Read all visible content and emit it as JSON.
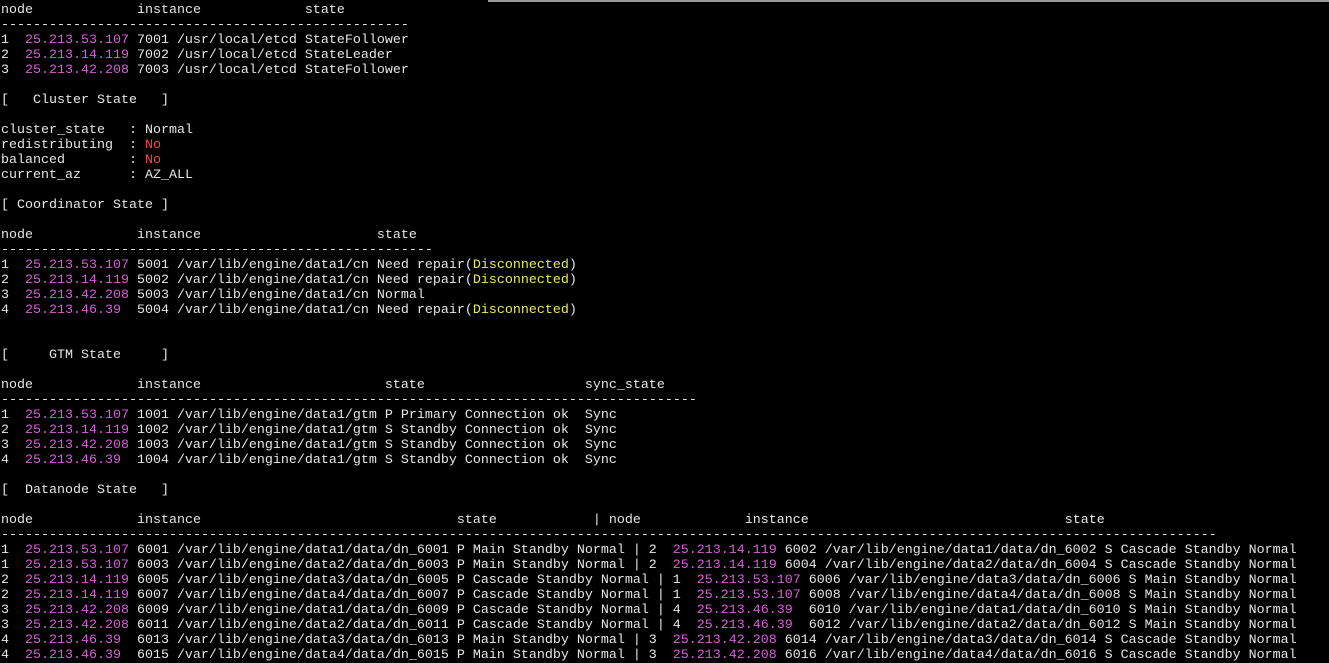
{
  "theme": {
    "background": "#000000",
    "foreground": "#e6e6e6",
    "ip_color": "#d75fd7",
    "error_color": "#f04848",
    "warning_color": "#ecec4a"
  },
  "etcd": {
    "header": {
      "node": "node",
      "instance": "instance",
      "state": "state"
    },
    "separator": "---------------------------------------------------",
    "rows": [
      {
        "node": "1",
        "ip": "25.213.53.107",
        "port": "7001",
        "path": "/usr/local/etcd",
        "state": "StateFollower"
      },
      {
        "node": "2",
        "ip": "25.213.14.119",
        "port": "7002",
        "path": "/usr/local/etcd",
        "state": "StateLeader"
      },
      {
        "node": "3",
        "ip": "25.213.42.208",
        "port": "7003",
        "path": "/usr/local/etcd",
        "state": "StateFollower"
      }
    ]
  },
  "cluster": {
    "title": "[   Cluster State   ]",
    "delimiter": ":",
    "items": [
      {
        "key": "cluster_state",
        "value": "Normal"
      },
      {
        "key": "redistributing",
        "value": "No"
      },
      {
        "key": "balanced",
        "value": "No"
      },
      {
        "key": "current_az",
        "value": "AZ_ALL"
      }
    ]
  },
  "coordinator": {
    "title": "[ Coordinator State ]",
    "header": {
      "node": "node",
      "instance": "instance",
      "state": "state"
    },
    "separator": "------------------------------------------------------",
    "detail_brackets": [
      "(",
      ")"
    ],
    "rows": [
      {
        "node": "1",
        "ip": "25.213.53.107",
        "port": "5001",
        "path": "/var/lib/engine/data1/cn",
        "state": "Need repair",
        "detail": "Disconnected"
      },
      {
        "node": "2",
        "ip": "25.213.14.119",
        "port": "5002",
        "path": "/var/lib/engine/data1/cn",
        "state": "Need repair",
        "detail": "Disconnected"
      },
      {
        "node": "3",
        "ip": "25.213.42.208",
        "port": "5003",
        "path": "/var/lib/engine/data1/cn",
        "state": "Normal"
      },
      {
        "node": "4",
        "ip": "25.213.46.39",
        "port": "5004",
        "path": "/var/lib/engine/data1/cn",
        "state": "Need repair",
        "detail": "Disconnected"
      }
    ]
  },
  "gtm": {
    "title": "[     GTM State     ]",
    "header": {
      "node": "node",
      "instance": "instance",
      "state": "state",
      "sync_state": "sync_state"
    },
    "separator": "---------------------------------------------------------------------------------------",
    "rows": [
      {
        "node": "1",
        "ip": "25.213.53.107",
        "port": "1001",
        "path": "/var/lib/engine/data1/gtm",
        "state": "P Primary Connection ok",
        "sync_state": "Sync"
      },
      {
        "node": "2",
        "ip": "25.213.14.119",
        "port": "1002",
        "path": "/var/lib/engine/data1/gtm",
        "state": "S Standby Connection ok",
        "sync_state": "Sync"
      },
      {
        "node": "3",
        "ip": "25.213.42.208",
        "port": "1003",
        "path": "/var/lib/engine/data1/gtm",
        "state": "S Standby Connection ok",
        "sync_state": "Sync"
      },
      {
        "node": "4",
        "ip": "25.213.46.39",
        "port": "1004",
        "path": "/var/lib/engine/data1/gtm",
        "state": "S Standby Connection ok",
        "sync_state": "Sync"
      }
    ]
  },
  "datanode": {
    "title": "[  Datanode State   ]",
    "header": {
      "node": "node",
      "instance": "instance",
      "state": "state"
    },
    "divider": "|",
    "separator": "--------------------------------------------------------------------------------------------------------------------------------------------------------",
    "rows": [
      {
        "left": {
          "node": "1",
          "ip": "25.213.53.107",
          "port": "6001",
          "path": "/var/lib/engine/data1/data/dn_6001",
          "state": "P Main Standby Normal"
        },
        "right": {
          "node": "2",
          "ip": "25.213.14.119",
          "port": "6002",
          "path": "/var/lib/engine/data1/data/dn_6002",
          "state": "S Cascade Standby Normal"
        }
      },
      {
        "left": {
          "node": "1",
          "ip": "25.213.53.107",
          "port": "6003",
          "path": "/var/lib/engine/data2/data/dn_6003",
          "state": "P Main Standby Normal"
        },
        "right": {
          "node": "2",
          "ip": "25.213.14.119",
          "port": "6004",
          "path": "/var/lib/engine/data2/data/dn_6004",
          "state": "S Cascade Standby Normal"
        }
      },
      {
        "left": {
          "node": "2",
          "ip": "25.213.14.119",
          "port": "6005",
          "path": "/var/lib/engine/data3/data/dn_6005",
          "state": "P Cascade Standby Normal"
        },
        "right": {
          "node": "1",
          "ip": "25.213.53.107",
          "port": "6006",
          "path": "/var/lib/engine/data3/data/dn_6006",
          "state": "S Main Standby Normal"
        }
      },
      {
        "left": {
          "node": "2",
          "ip": "25.213.14.119",
          "port": "6007",
          "path": "/var/lib/engine/data4/data/dn_6007",
          "state": "P Cascade Standby Normal"
        },
        "right": {
          "node": "1",
          "ip": "25.213.53.107",
          "port": "6008",
          "path": "/var/lib/engine/data4/data/dn_6008",
          "state": "S Main Standby Normal"
        }
      },
      {
        "left": {
          "node": "3",
          "ip": "25.213.42.208",
          "port": "6009",
          "path": "/var/lib/engine/data1/data/dn_6009",
          "state": "P Cascade Standby Normal"
        },
        "right": {
          "node": "4",
          "ip": "25.213.46.39",
          "port": "6010",
          "path": "/var/lib/engine/data1/data/dn_6010",
          "state": "S Main Standby Normal"
        }
      },
      {
        "left": {
          "node": "3",
          "ip": "25.213.42.208",
          "port": "6011",
          "path": "/var/lib/engine/data2/data/dn_6011",
          "state": "P Cascade Standby Normal"
        },
        "right": {
          "node": "4",
          "ip": "25.213.46.39",
          "port": "6012",
          "path": "/var/lib/engine/data2/data/dn_6012",
          "state": "S Main Standby Normal"
        }
      },
      {
        "left": {
          "node": "4",
          "ip": "25.213.46.39",
          "port": "6013",
          "path": "/var/lib/engine/data3/data/dn_6013",
          "state": "P Main Standby Normal"
        },
        "right": {
          "node": "3",
          "ip": "25.213.42.208",
          "port": "6014",
          "path": "/var/lib/engine/data3/data/dn_6014",
          "state": "S Cascade Standby Normal"
        }
      },
      {
        "left": {
          "node": "4",
          "ip": "25.213.46.39",
          "port": "6015",
          "path": "/var/lib/engine/data4/data/dn_6015",
          "state": "P Main Standby Normal"
        },
        "right": {
          "node": "3",
          "ip": "25.213.42.208",
          "port": "6016",
          "path": "/var/lib/engine/data4/data/dn_6016",
          "state": "S Cascade Standby Normal"
        }
      }
    ]
  }
}
